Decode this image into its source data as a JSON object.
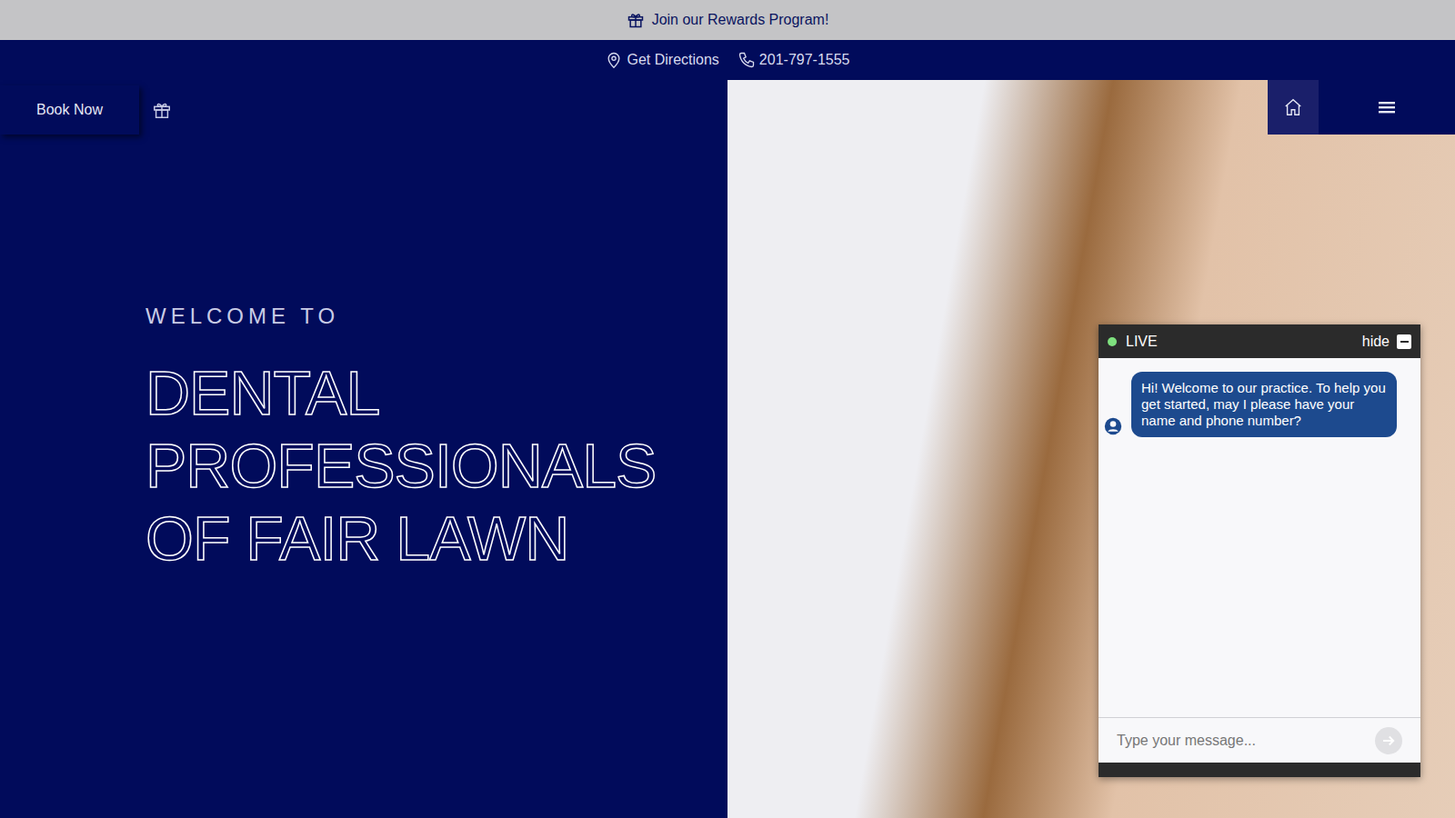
{
  "top_bar": {
    "label": "Join our Rewards Program!"
  },
  "info_bar": {
    "directions": "Get Directions",
    "phone": "201-797-1555"
  },
  "nav": {
    "book": "Book Now"
  },
  "hero": {
    "eyebrow": "WELCOME TO",
    "title_lines": [
      "DENTAL",
      "PROFESSIONALS",
      "OF FAIR LAWN"
    ]
  },
  "chat": {
    "status": "LIVE",
    "online": true,
    "hide": "hide",
    "messages": [
      {
        "text": "Hi! Welcome to our practice. To help you get started, may I please have your name and phone number?"
      }
    ],
    "input": {
      "placeholder": "Type your message..."
    }
  }
}
